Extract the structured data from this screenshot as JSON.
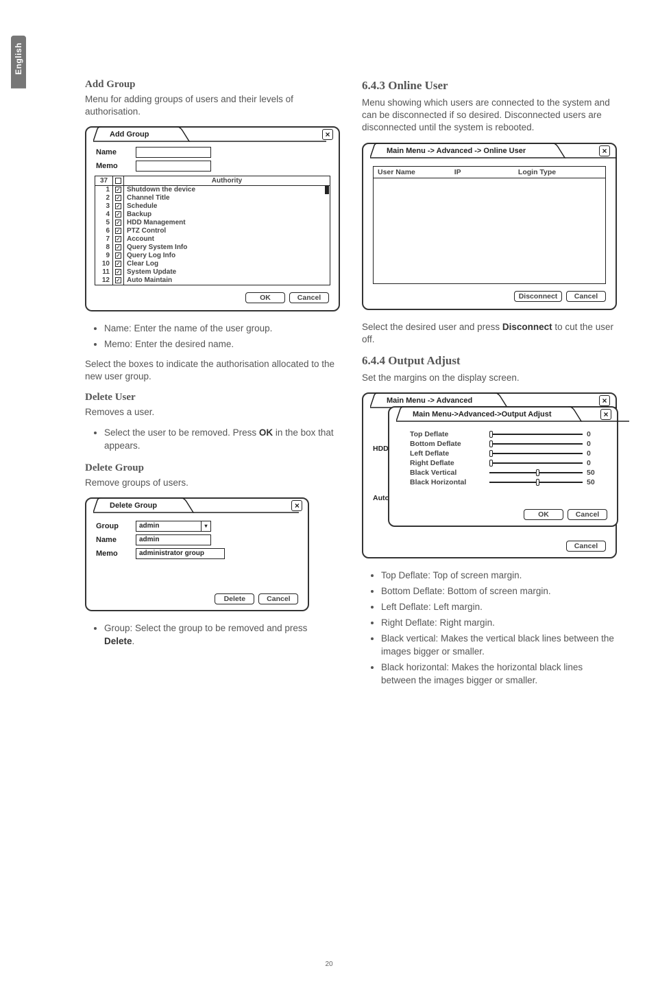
{
  "page_number": "20",
  "side_tab": "English",
  "left": {
    "add_group": {
      "title": "Add Group",
      "intro": "Menu for adding groups of users and their levels of authorisation.",
      "dialog_title": "Add Group",
      "name_label": "Name",
      "memo_label": "Memo",
      "auth_count": "37",
      "auth_header": "Authority",
      "authorities": [
        {
          "n": "1",
          "label": "Shutdown the device"
        },
        {
          "n": "2",
          "label": "Channel Title"
        },
        {
          "n": "3",
          "label": "Schedule"
        },
        {
          "n": "4",
          "label": "Backup"
        },
        {
          "n": "5",
          "label": "HDD Management"
        },
        {
          "n": "6",
          "label": "PTZ Control"
        },
        {
          "n": "7",
          "label": "Account"
        },
        {
          "n": "8",
          "label": "Query System Info"
        },
        {
          "n": "9",
          "label": "Query Log Info"
        },
        {
          "n": "10",
          "label": "Clear Log"
        },
        {
          "n": "11",
          "label": "System Update"
        },
        {
          "n": "12",
          "label": "Auto Maintain"
        }
      ],
      "ok_button": "OK",
      "cancel_button": "Cancel",
      "bullet_name": "Name: Enter the name of the user group.",
      "bullet_memo": "Memo: Enter the desired name.",
      "select_boxes": "Select the boxes to indicate the authorisation allocated to the new user group."
    },
    "delete_user": {
      "title": "Delete User",
      "intro": "Removes a user.",
      "bullet_pre": "Select the user to be removed. Press ",
      "bullet_bold": "OK",
      "bullet_post": " in the box that appears."
    },
    "delete_group": {
      "title": "Delete Group",
      "intro": "Remove groups of users.",
      "dialog_title": "Delete Group",
      "group_label": "Group",
      "name_label": "Name",
      "memo_label": "Memo",
      "group_value": "admin",
      "name_value": "admin",
      "memo_value": "administrator group",
      "delete_button": "Delete",
      "cancel_button": "Cancel",
      "bullet_pre": "Group: Select the group to be removed and press ",
      "bullet_bold": "Delete",
      "bullet_post": "."
    }
  },
  "right": {
    "online_user": {
      "heading": "6.4.3 Online User",
      "intro": "Menu showing which users are connected to the system and can be disconnected if so desired. Disconnected users are disconnected until the system is rebooted.",
      "dialog_title": "Main Menu -> Advanced -> Online User",
      "col_user": "User Name",
      "col_ip": "IP",
      "col_login": "Login Type",
      "disconnect_button": "Disconnect",
      "cancel_button": "Cancel",
      "note_pre": "Select the desired user and press ",
      "note_bold": "Disconnect",
      "note_post": " to cut the user off."
    },
    "output_adjust": {
      "heading": "6.4.4 Output Adjust",
      "intro": "Set the margins on the display screen.",
      "bg_dialog_title": "Main Menu -> Advanced",
      "bg_hdd": "HDD",
      "bg_auto": "Auto",
      "nest_dialog_title": "Main Menu->Advanced->Output Adjust",
      "sliders": [
        {
          "label": "Top Deflate",
          "value": "0",
          "pos": 0
        },
        {
          "label": "Bottom Deflate",
          "value": "0",
          "pos": 0
        },
        {
          "label": "Left Deflate",
          "value": "0",
          "pos": 0
        },
        {
          "label": "Right Deflate",
          "value": "0",
          "pos": 0
        },
        {
          "label": "Black Vertical",
          "value": "50",
          "pos": 50
        },
        {
          "label": "Black Horizontal",
          "value": "50",
          "pos": 50
        }
      ],
      "ok_button": "OK",
      "cancel_button": "Cancel",
      "outer_cancel": "Cancel",
      "bullets": [
        "Top Deflate: Top of screen margin.",
        "Bottom Deflate: Bottom of screen margin.",
        "Left Deflate: Left margin.",
        "Right Deflate: Right margin.",
        "Black vertical: Makes the vertical black lines between the images bigger or smaller.",
        "Black horizontal: Makes the horizontal black lines between the images bigger or smaller."
      ]
    }
  }
}
